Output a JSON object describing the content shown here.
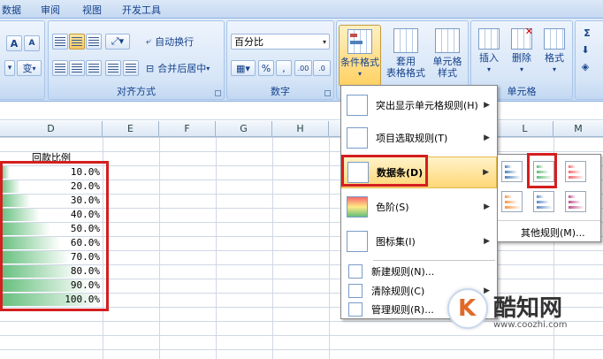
{
  "tabs": [
    "数据",
    "审阅",
    "视图",
    "开发工具"
  ],
  "ribbon": {
    "font_group": {
      "grow": "A",
      "shrink": "A",
      "phonetic": "变"
    },
    "align_group": {
      "label": "对齐方式",
      "wrap": "自动换行",
      "merge": "合并后居中"
    },
    "number_group": {
      "label": "数字",
      "format_value": "百分比",
      "percent": "%",
      "comma": ",",
      "inc_dec": ".00",
      "dec_dec": ".0"
    },
    "styles": {
      "conditional_format": "条件格式",
      "table_format_1": "套用",
      "table_format_2": "表格格式",
      "cell_style_1": "单元格",
      "cell_style_2": "样式"
    },
    "cells_group": {
      "label": "单元格",
      "insert": "插入",
      "delete": "删除",
      "format": "格式"
    },
    "editing": {
      "sum": "Σ"
    }
  },
  "columns": [
    "D",
    "E",
    "F",
    "G",
    "H",
    "L",
    "M"
  ],
  "sheet": {
    "header": "回款比例",
    "values": [
      {
        "text": "10.0%",
        "fill": 0.1
      },
      {
        "text": "20.0%",
        "fill": 0.2
      },
      {
        "text": "30.0%",
        "fill": 0.3
      },
      {
        "text": "40.0%",
        "fill": 0.4
      },
      {
        "text": "50.0%",
        "fill": 0.5
      },
      {
        "text": "60.0%",
        "fill": 0.6
      },
      {
        "text": "70.0%",
        "fill": 0.7
      },
      {
        "text": "80.0%",
        "fill": 0.8
      },
      {
        "text": "90.0%",
        "fill": 0.9
      },
      {
        "text": "100.0%",
        "fill": 1.0
      }
    ]
  },
  "menu": {
    "highlight_rules": "突出显示单元格规则(H)",
    "top_bottom": "项目选取规则(T)",
    "data_bars": "数据条(D)",
    "color_scales": "色阶(S)",
    "icon_sets": "图标集(I)",
    "new_rule": "新建规则(N)...",
    "clear_rules": "清除规则(C)",
    "manage_rules": "管理规则(R)..."
  },
  "submenu": {
    "more_rules": "其他规则(M)...",
    "bar_colors": [
      "#4f81bd",
      "#63be7b",
      "#f8696b",
      "#f79646",
      "#5a8ac6",
      "#c0508c"
    ]
  },
  "watermark": {
    "title": "酷知网",
    "url": "www.coozhi.com"
  },
  "colors": {
    "highlight": "#d41f1f",
    "bar_green": "#63be7b"
  }
}
